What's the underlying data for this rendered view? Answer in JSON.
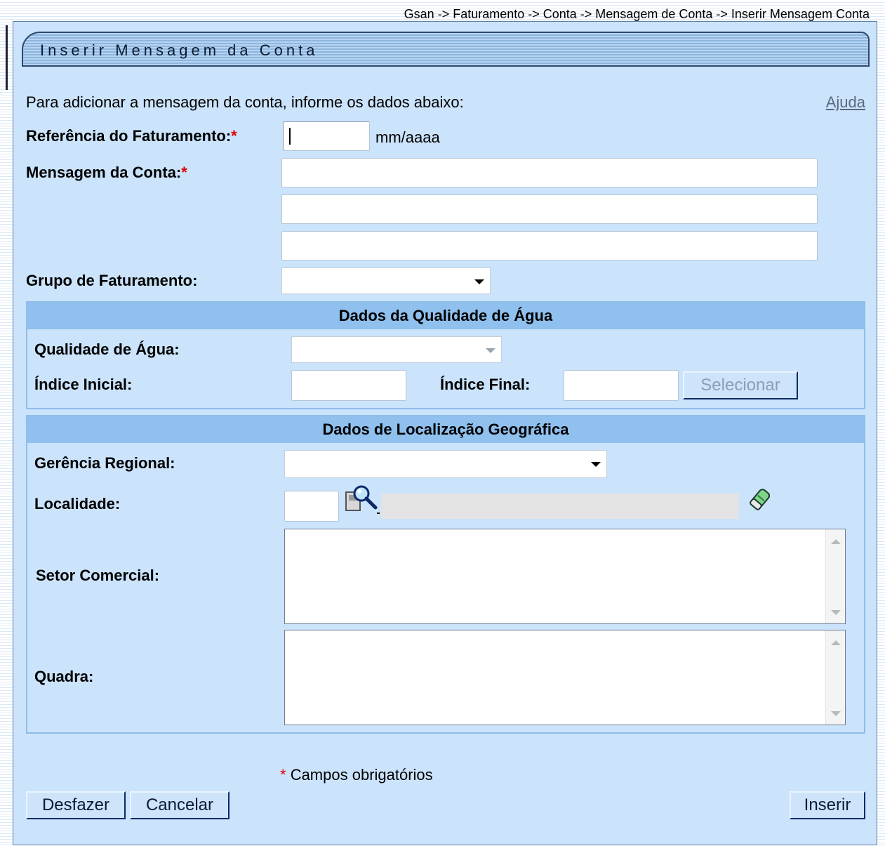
{
  "breadcrumb": "Gsan -> Faturamento -> Conta -> Mensagem de Conta -> Inserir Mensagem Conta",
  "page_title": "Inserir Mensagem da Conta",
  "intro_text": "Para adicionar a mensagem da conta, informe os dados abaixo:",
  "help_link": "Ajuda",
  "form": {
    "referencia_label": "Referência do Faturamento:",
    "required_mark": "*",
    "referencia_value": "",
    "referencia_hint": "mm/aaaa",
    "mensagem_label": "Mensagem da Conta:",
    "mensagem_linha1": "",
    "mensagem_linha2": "",
    "mensagem_linha3": "",
    "grupo_label": "Grupo de Faturamento:",
    "grupo_selected": ""
  },
  "qualidade": {
    "header": "Dados da Qualidade de Água",
    "qualidade_label": "Qualidade de Água:",
    "qualidade_selected": "",
    "indice_inicial_label": "Índice Inicial:",
    "indice_final_label": "Índice Final:",
    "selecionar_button": "Selecionar"
  },
  "localizacao": {
    "header": "Dados de Localização Geográfica",
    "gerencia_label": "Gerência Regional:",
    "gerencia_selected": "",
    "localidade_label": "Localidade:",
    "localidade_code": "",
    "localidade_descricao": "",
    "setor_label": "Setor Comercial:",
    "quadra_label": "Quadra:"
  },
  "footer": {
    "required_note": "Campos obrigatórios",
    "desfazer_button": "Desfazer",
    "cancelar_button": "Cancelar",
    "inserir_button": "Inserir"
  },
  "colors": {
    "panel_bg": "#cbe3fb",
    "section_header": "#8fc0ee",
    "required": "#e00000",
    "button_bg": "#cde4fb"
  },
  "icons": [
    "search-icon",
    "eraser-icon",
    "dropdown-arrow-icon",
    "scroll-up-icon",
    "scroll-down-icon"
  ]
}
